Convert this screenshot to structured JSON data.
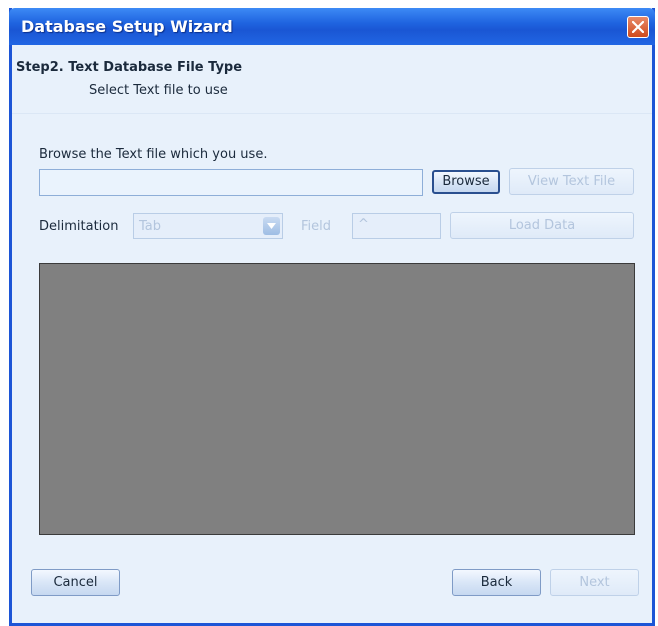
{
  "window": {
    "title": "Database Setup Wizard"
  },
  "header": {
    "step_title": "Step2. Text Database File Type",
    "step_subtitle": "Select Text file to use"
  },
  "browse": {
    "label": "Browse the Text file which you use.",
    "file_value": "",
    "browse_button": "Browse",
    "view_button": "View Text File"
  },
  "options": {
    "delimitation_label": "Delimitation",
    "delimitation_value": "Tab",
    "field_label": "Field",
    "field_value": "^",
    "load_button": "Load Data"
  },
  "footer": {
    "cancel_button": "Cancel",
    "back_button": "Back",
    "next_button": "Next"
  },
  "colors": {
    "titlebar": "#1f64e0",
    "background": "#e8f1fb",
    "data_panel": "#808080",
    "close_button": "#cf4a1c"
  }
}
